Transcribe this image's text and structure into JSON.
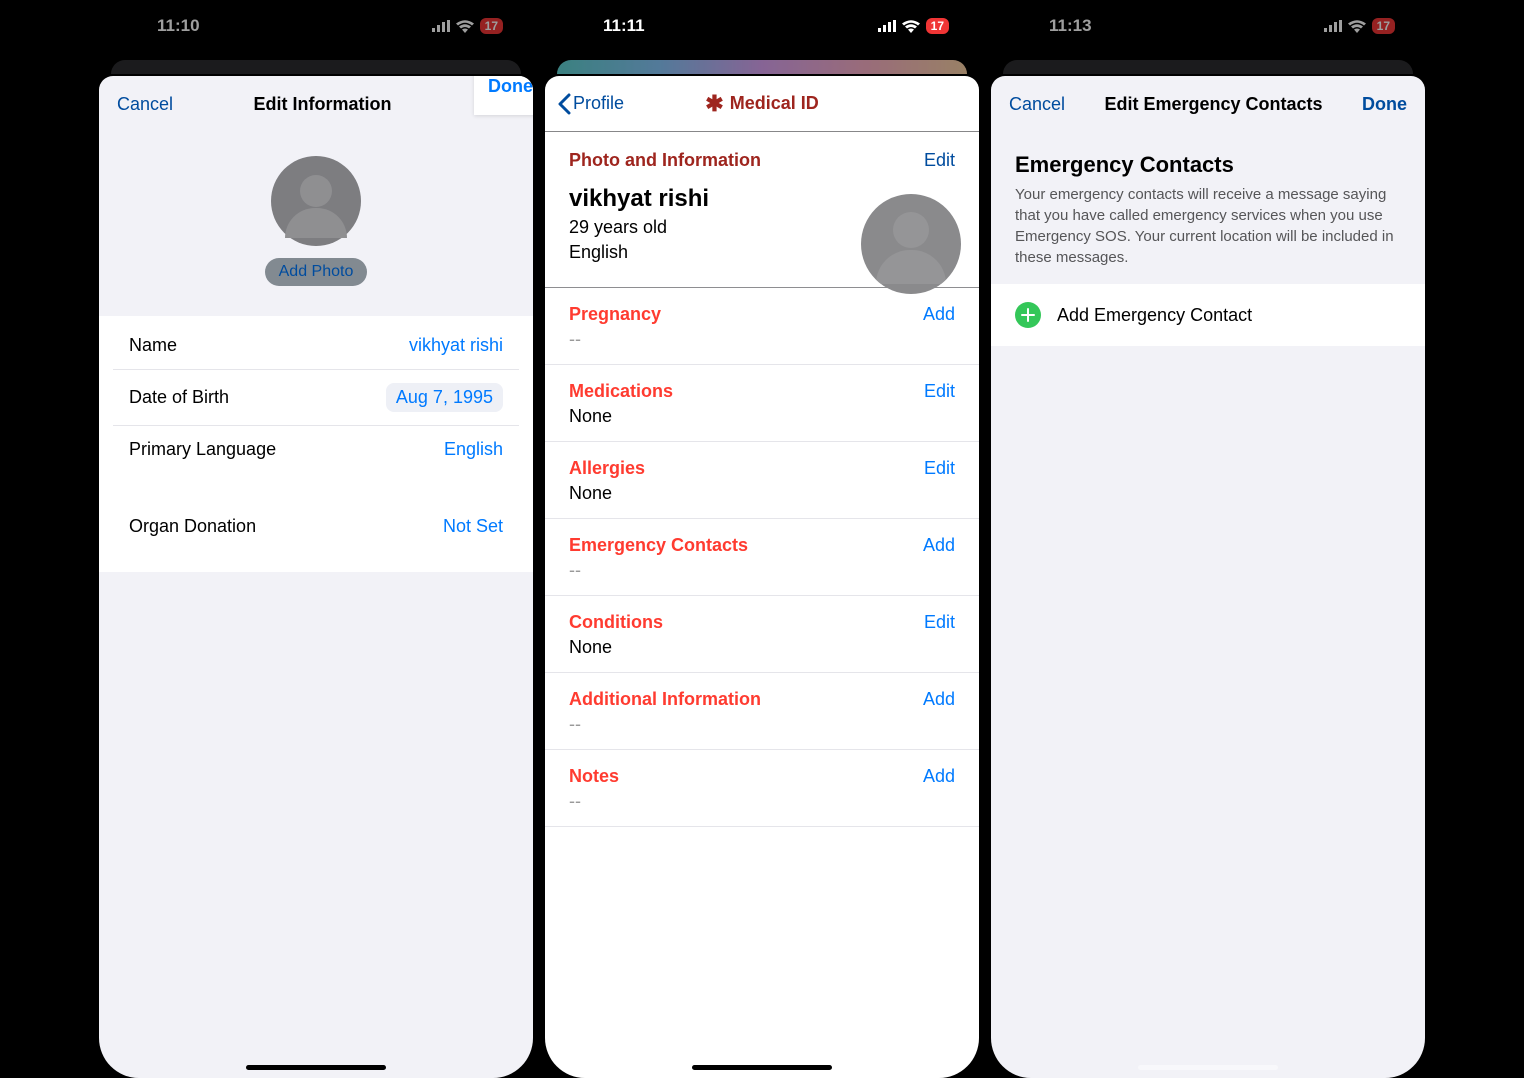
{
  "panel1": {
    "status_time": "11:10",
    "battery": "17",
    "nav": {
      "cancel": "Cancel",
      "title": "Edit Information",
      "done": "Done"
    },
    "add_photo": "Add Photo",
    "rows": {
      "name": {
        "label": "Name",
        "value": "vikhyat rishi"
      },
      "dob": {
        "label": "Date of Birth",
        "value": "Aug 7, 1995"
      },
      "lang": {
        "label": "Primary Language",
        "value": "English"
      },
      "organ": {
        "label": "Organ Donation",
        "value": "Not Set"
      }
    }
  },
  "panel2": {
    "status_time": "11:11",
    "battery": "17",
    "back_label": "Profile",
    "title": "Medical ID",
    "info": {
      "header": "Photo and Information",
      "edit": "Edit",
      "name": "vikhyat rishi",
      "age": "29 years old",
      "lang": "English"
    },
    "items": [
      {
        "label": "Pregnancy",
        "action": "Add",
        "value": "--"
      },
      {
        "label": "Medications",
        "action": "Edit",
        "value": "None"
      },
      {
        "label": "Allergies",
        "action": "Edit",
        "value": "None"
      },
      {
        "label": "Emergency Contacts",
        "action": "Add",
        "value": "--"
      },
      {
        "label": "Conditions",
        "action": "Edit",
        "value": "None"
      },
      {
        "label": "Additional Information",
        "action": "Add",
        "value": "--"
      },
      {
        "label": "Notes",
        "action": "Add",
        "value": "--"
      }
    ]
  },
  "panel3": {
    "status_time": "11:13",
    "battery": "17",
    "nav": {
      "cancel": "Cancel",
      "title": "Edit Emergency Contacts",
      "done": "Done"
    },
    "section_title": "Emergency Contacts",
    "section_desc": "Your emergency contacts will receive a message saying that you have called emergency services when you use Emergency SOS. Your current location will be included in these messages.",
    "add_label": "Add Emergency Contact"
  }
}
